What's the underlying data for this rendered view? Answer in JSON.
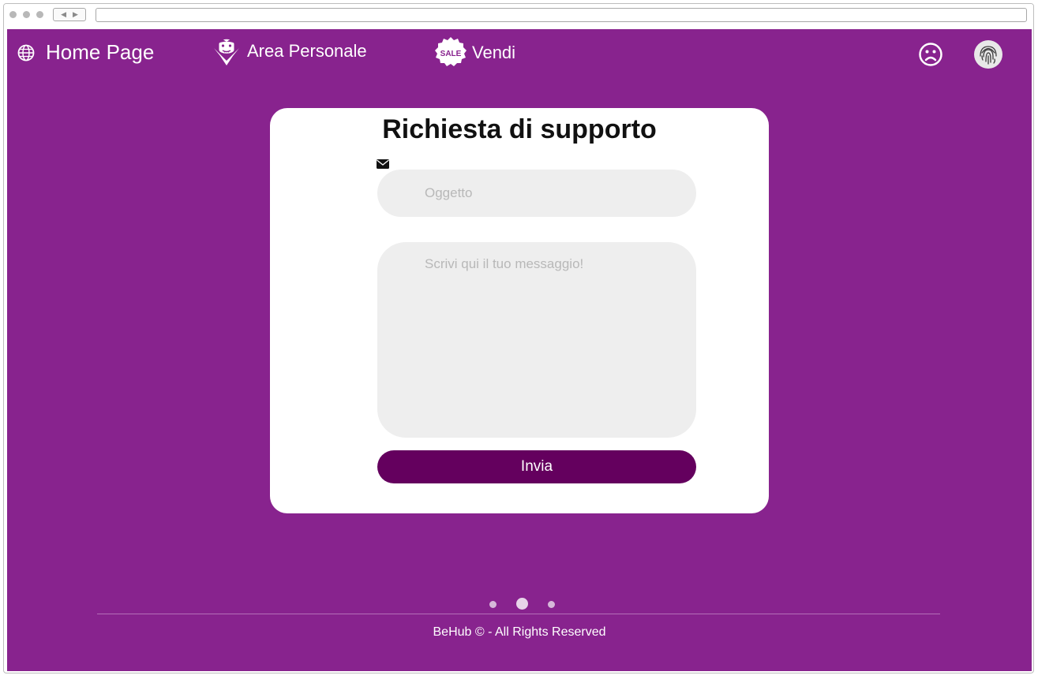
{
  "nav": {
    "home_label": "Home Page",
    "area_label": "Area Personale",
    "sell_label": "Vendi",
    "sale_badge": "SALE"
  },
  "form": {
    "title": "Richiesta di supporto",
    "subject_placeholder": "Oggetto",
    "message_placeholder": "Scrivi qui il tuo messaggio!",
    "submit_label": "Invia"
  },
  "carousel": {
    "dot_count": 3,
    "active_index": 1
  },
  "footer": {
    "copyright": "BeHub © - All Rights Reserved"
  },
  "icons": {
    "home": "globe-icon",
    "area": "vampire-icon",
    "sell": "sale-badge-icon",
    "feedback": "sad-face-icon",
    "account": "fingerprint-icon",
    "subject": "envelope-icon"
  },
  "colors": {
    "background": "#88238e",
    "button": "#64005e",
    "field": "#eeeeee",
    "card": "#ffffff"
  }
}
